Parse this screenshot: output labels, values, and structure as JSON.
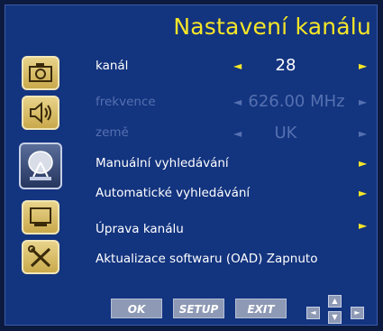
{
  "title": "Nastavení kanálu",
  "menu": {
    "channel": {
      "label": "kanál",
      "value": "28"
    },
    "frequency": {
      "label": "frekvence",
      "value": "626.00 MHz"
    },
    "country": {
      "label": "země",
      "value": "UK"
    },
    "manual_search": {
      "label": "Manuální vyhledávání"
    },
    "auto_search": {
      "label": "Automatické vyhledávání"
    },
    "edit_channel": {
      "label": "Úprava kanálu"
    },
    "software_update": {
      "label": "Aktualizace softwaru (OAD) Zapnuto"
    }
  },
  "sidebar_icons": [
    "camera-icon",
    "speaker-icon",
    "satellite-dish-icon",
    "monitor-icon",
    "tools-icon"
  ],
  "buttons": {
    "ok": "OK",
    "setup": "SETUP",
    "exit": "EXIT"
  },
  "nav_glyphs": {
    "left": "◄",
    "up": "▲",
    "down": "▼",
    "right": "►",
    "arrow_left": "◄",
    "arrow_right": "►"
  },
  "colors": {
    "background": "#13347f",
    "title": "#f5e628",
    "text": "#ffffff",
    "disabled": "#5570b0",
    "arrow": "#f5e628"
  }
}
